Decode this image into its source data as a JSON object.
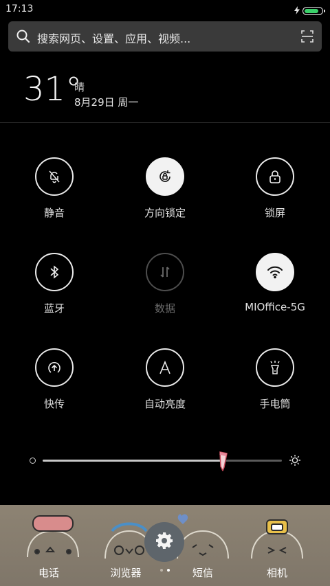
{
  "status": {
    "time": "17:13"
  },
  "search": {
    "placeholder": "搜索网页、设置、应用、视频..."
  },
  "weather": {
    "temperature": "31°",
    "condition": "晴",
    "date": "8月29日 周一"
  },
  "toggles": [
    {
      "label": "静音",
      "icon": "bell-off-icon",
      "state": "off"
    },
    {
      "label": "方向锁定",
      "icon": "rotation-lock-icon",
      "state": "on"
    },
    {
      "label": "锁屏",
      "icon": "lock-icon",
      "state": "off"
    },
    {
      "label": "蓝牙",
      "icon": "bluetooth-icon",
      "state": "off"
    },
    {
      "label": "数据",
      "icon": "data-arrows-icon",
      "state": "disabled"
    },
    {
      "label": "MIOffice-5G",
      "icon": "wifi-icon",
      "state": "on"
    },
    {
      "label": "快传",
      "icon": "share-icon",
      "state": "off"
    },
    {
      "label": "自动亮度",
      "icon": "auto-brightness-icon",
      "state": "off"
    },
    {
      "label": "手电筒",
      "icon": "flashlight-icon",
      "state": "off"
    }
  ],
  "brightness": {
    "level": 0.75
  },
  "dock": [
    {
      "label": "电话",
      "icon": "phone-app-icon"
    },
    {
      "label": "浏览器",
      "icon": "browser-app-icon"
    },
    {
      "label": "短信",
      "icon": "messages-app-icon"
    },
    {
      "label": "相机",
      "icon": "camera-app-icon"
    }
  ],
  "colors": {
    "battery": "#3ad16a",
    "active_toggle": "#f2f2f2"
  }
}
